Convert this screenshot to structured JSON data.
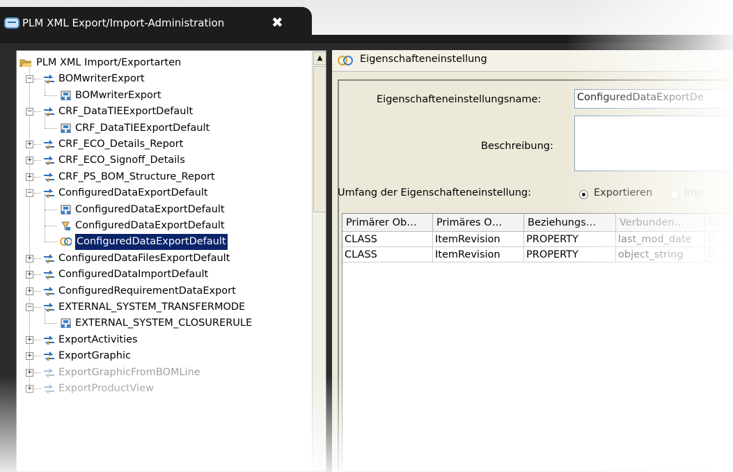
{
  "tab": {
    "title": "PLM XML Export/Import-Administration",
    "close": "✖"
  },
  "tree": {
    "root": "PLM XML Import/Exportarten",
    "items": [
      {
        "label": "BOMwriterExport",
        "level": 1,
        "expander": "−",
        "icon": "transfer-mode-icon"
      },
      {
        "label": "BOMwriterExport",
        "level": 2,
        "icon": "closure-rule-icon"
      },
      {
        "label": "CRF_DataTIEExportDefault",
        "level": 1,
        "expander": "−",
        "icon": "transfer-mode-icon"
      },
      {
        "label": "CRF_DataTIEExportDefault",
        "level": 2,
        "icon": "closure-rule-icon"
      },
      {
        "label": "CRF_ECO_Details_Report",
        "level": 1,
        "expander": "+",
        "icon": "transfer-mode-icon"
      },
      {
        "label": "CRF_ECO_Signoff_Details",
        "level": 1,
        "expander": "+",
        "icon": "transfer-mode-icon"
      },
      {
        "label": "CRF_PS_BOM_Structure_Report",
        "level": 1,
        "expander": "+",
        "icon": "transfer-mode-icon"
      },
      {
        "label": "ConfiguredDataExportDefault",
        "level": 1,
        "expander": "−",
        "icon": "transfer-mode-icon"
      },
      {
        "label": "ConfiguredDataExportDefault",
        "level": 2,
        "icon": "closure-rule-icon"
      },
      {
        "label": "ConfiguredDataExportDefault",
        "level": 2,
        "icon": "filter-rule-icon"
      },
      {
        "label": "ConfiguredDataExportDefault",
        "level": 2,
        "icon": "property-set-icon",
        "selected": true
      },
      {
        "label": "ConfiguredDataFilesExportDefault",
        "level": 1,
        "expander": "+",
        "icon": "transfer-mode-icon"
      },
      {
        "label": "ConfiguredDataImportDefault",
        "level": 1,
        "expander": "+",
        "icon": "transfer-mode-icon"
      },
      {
        "label": "ConfiguredRequirementDataExport",
        "level": 1,
        "expander": "+",
        "icon": "transfer-mode-icon"
      },
      {
        "label": "EXTERNAL_SYSTEM_TRANSFERMODE",
        "level": 1,
        "expander": "−",
        "icon": "transfer-mode-icon"
      },
      {
        "label": "EXTERNAL_SYSTEM_CLOSURERULE",
        "level": 2,
        "icon": "closure-rule-icon"
      },
      {
        "label": "ExportActivities",
        "level": 1,
        "expander": "+",
        "icon": "transfer-mode-icon"
      },
      {
        "label": "ExportGraphic",
        "level": 1,
        "expander": "+",
        "icon": "transfer-mode-icon"
      },
      {
        "label": "ExportGraphicFromBOMLine",
        "level": 1,
        "expander": "+",
        "icon": "transfer-mode-icon"
      },
      {
        "label": "ExportProductView",
        "level": 1,
        "expander": "+",
        "icon": "transfer-mode-icon"
      }
    ]
  },
  "panel": {
    "title": "Eigenschafteneinstellung",
    "name_label": "Eigenschafteneinstellungsname:",
    "name_value": "ConfiguredDataExportDe",
    "desc_label": "Beschreibung:",
    "desc_value": "",
    "scope_label": "Umfang der Eigenschafteneinstellung:",
    "scope_export": "Exportieren",
    "scope_import": "Imp",
    "scope_selected": "Exportieren"
  },
  "table": {
    "columns": [
      "Primärer Ob…",
      "Primäres O…",
      "Beziehungs…",
      "Verbunden…",
      "E"
    ],
    "rows": [
      [
        "CLASS",
        "ItemRevision",
        "PROPERTY",
        "last_mod_date",
        "D"
      ],
      [
        "CLASS",
        "ItemRevision",
        "PROPERTY",
        "object_string",
        "D"
      ]
    ]
  },
  "colors": {
    "selection": "#0a246a",
    "accent": "#3b82c4",
    "panel_bg": "#ece9d8"
  }
}
